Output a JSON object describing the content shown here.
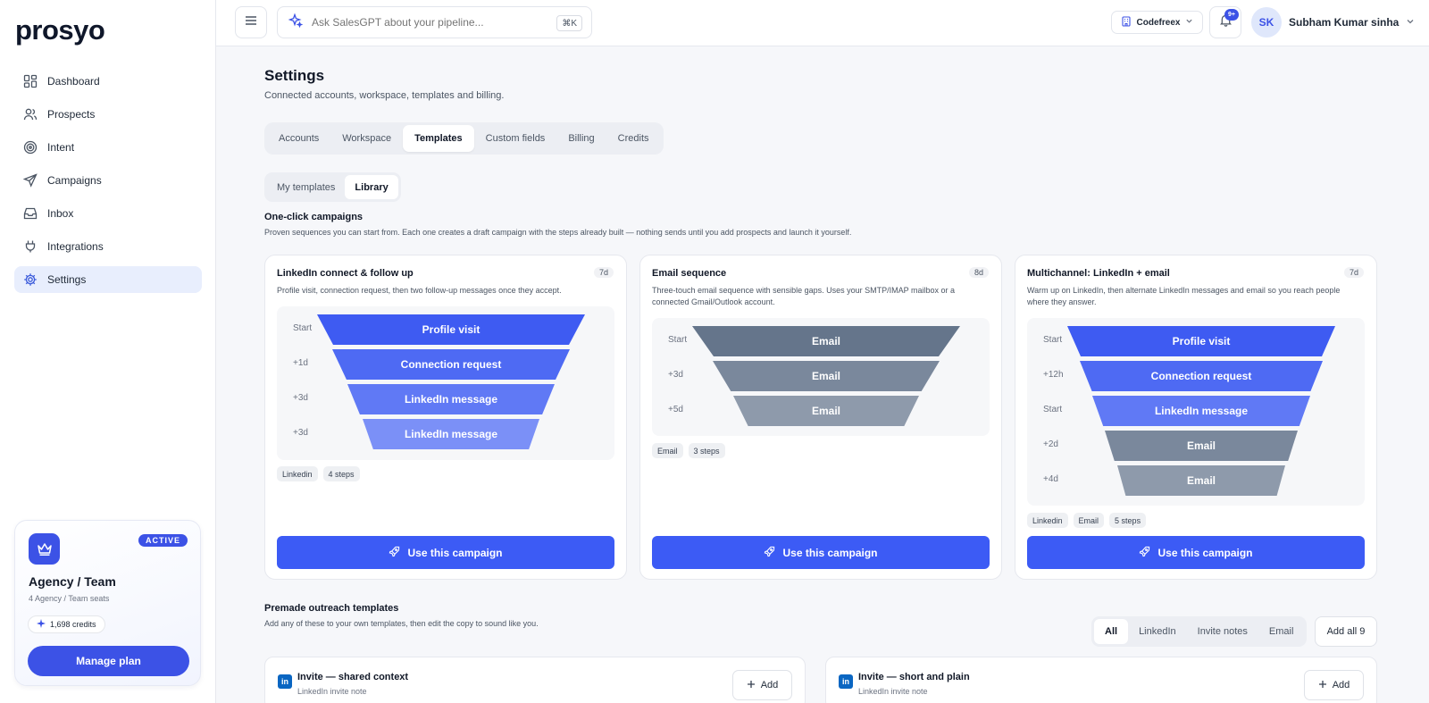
{
  "app": {
    "logo": "prosyo"
  },
  "sidebar": {
    "items": [
      {
        "label": "Dashboard",
        "icon": "dashboard-icon"
      },
      {
        "label": "Prospects",
        "icon": "users-icon"
      },
      {
        "label": "Intent",
        "icon": "target-icon"
      },
      {
        "label": "Campaigns",
        "icon": "send-icon"
      },
      {
        "label": "Inbox",
        "icon": "inbox-icon"
      },
      {
        "label": "Integrations",
        "icon": "plug-icon"
      },
      {
        "label": "Settings",
        "icon": "gear-icon",
        "active": true
      }
    ],
    "plan": {
      "badge": "ACTIVE",
      "title": "Agency / Team",
      "seats": "4 Agency / Team seats",
      "credits": "1,698 credits",
      "manage_label": "Manage plan"
    }
  },
  "topbar": {
    "search_placeholder": "Ask SalesGPT about your pipeline...",
    "shortcut": "⌘K",
    "workspace": "Codefreex",
    "notifications_badge": "9+",
    "user_initials": "SK",
    "user_name": "Subham Kumar sinha"
  },
  "page": {
    "title": "Settings",
    "subtitle": "Connected accounts, workspace, templates and billing.",
    "tabs": [
      "Accounts",
      "Workspace",
      "Templates",
      "Custom fields",
      "Billing",
      "Credits"
    ],
    "active_tab": "Templates",
    "subtabs": [
      "My templates",
      "Library"
    ],
    "active_subtab": "Library"
  },
  "campaigns_section": {
    "title": "One-click campaigns",
    "subtitle": "Proven sequences you can start from. Each one creates a draft campaign with the steps already built — nothing sends until you add prospects and launch it yourself.",
    "use_label": "Use this campaign",
    "cards": [
      {
        "title": "LinkedIn connect & follow up",
        "days": "7d",
        "desc": "Profile visit, connection request, then two follow-up messages once they accept.",
        "steps": [
          {
            "delay": "Start",
            "label": "Profile visit"
          },
          {
            "delay": "+1d",
            "label": "Connection request"
          },
          {
            "delay": "+3d",
            "label": "LinkedIn message"
          },
          {
            "delay": "+3d",
            "label": "LinkedIn message"
          }
        ],
        "tags": [
          "Linkedin",
          "4 steps"
        ]
      },
      {
        "title": "Email sequence",
        "days": "8d",
        "desc": "Three-touch email sequence with sensible gaps. Uses your SMTP/IMAP mailbox or a connected Gmail/Outlook account.",
        "steps": [
          {
            "delay": "Start",
            "label": "Email"
          },
          {
            "delay": "+3d",
            "label": "Email"
          },
          {
            "delay": "+5d",
            "label": "Email"
          }
        ],
        "tags": [
          "Email",
          "3 steps"
        ]
      },
      {
        "title": "Multichannel: LinkedIn + email",
        "days": "7d",
        "desc": "Warm up on LinkedIn, then alternate LinkedIn messages and email so you reach people where they answer.",
        "steps": [
          {
            "delay": "Start",
            "label": "Profile visit"
          },
          {
            "delay": "+12h",
            "label": "Connection request"
          },
          {
            "delay": "Start",
            "label": "LinkedIn message"
          },
          {
            "delay": "+2d",
            "label": "Email"
          },
          {
            "delay": "+4d",
            "label": "Email"
          }
        ],
        "tags": [
          "Linkedin",
          "Email",
          "5 steps"
        ]
      }
    ]
  },
  "templates_section": {
    "title": "Premade outreach templates",
    "subtitle": "Add any of these to your own templates, then edit the copy to sound like you.",
    "filters": [
      "All",
      "LinkedIn",
      "Invite notes",
      "Email"
    ],
    "active_filter": "All",
    "add_all_label": "Add all 9",
    "add_label": "Add",
    "items": [
      {
        "title": "Invite — shared context",
        "type": "LinkedIn invite note",
        "icon_text": "in"
      },
      {
        "title": "Invite — short and plain",
        "type": "LinkedIn invite note",
        "icon_text": "in"
      }
    ]
  },
  "colors": {
    "primary": "#3c5bf5",
    "linkedin_step_1": "#3e5bf2",
    "linkedin_step_2": "#4e6af3",
    "linkedin_step_3": "#6079f5",
    "linkedin_step_4": "#7b90f7",
    "email_step_1": "#65758b",
    "email_step_2": "#7a889c",
    "email_step_3": "#8e9aab"
  }
}
